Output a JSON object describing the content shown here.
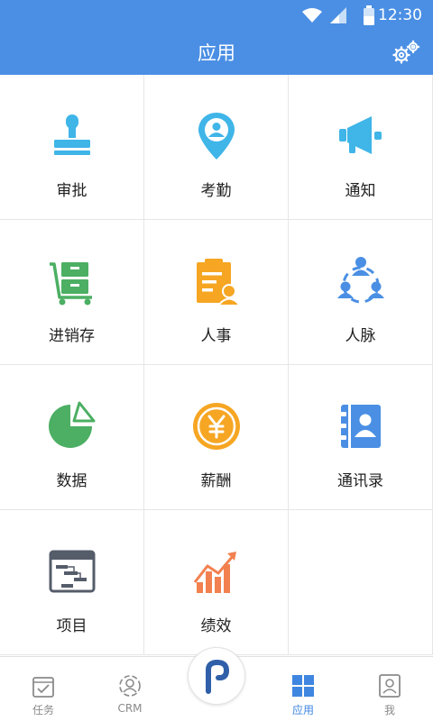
{
  "status_bar": {
    "time": "12:30",
    "icons": [
      "wifi-icon",
      "signal-icon",
      "battery-icon"
    ]
  },
  "header": {
    "title": "应用",
    "settings_icon": "gear-icon"
  },
  "apps": [
    {
      "label": "审批",
      "icon": "stamp-icon",
      "color": "#3fb5e8"
    },
    {
      "label": "考勤",
      "icon": "location-person-icon",
      "color": "#3fb5e8"
    },
    {
      "label": "通知",
      "icon": "megaphone-icon",
      "color": "#3fb5e8"
    },
    {
      "label": "进销存",
      "icon": "cart-icon",
      "color": "#4caf63"
    },
    {
      "label": "人事",
      "icon": "clipboard-person-icon",
      "color": "#f6a623"
    },
    {
      "label": "人脉",
      "icon": "network-people-icon",
      "color": "#4a8fe4"
    },
    {
      "label": "数据",
      "icon": "pie-chart-icon",
      "color": "#4caf63"
    },
    {
      "label": "薪酬",
      "icon": "yuan-coin-icon",
      "color": "#f6a623"
    },
    {
      "label": "通讯录",
      "icon": "contacts-book-icon",
      "color": "#4a8fe4"
    },
    {
      "label": "项目",
      "icon": "gantt-chart-icon",
      "color": "#555c6a"
    },
    {
      "label": "绩效",
      "icon": "bar-chart-trend-icon",
      "color": "#f2814f"
    }
  ],
  "tabs": [
    {
      "label": "任务",
      "icon": "task-icon",
      "active": false
    },
    {
      "label": "CRM",
      "icon": "crm-icon",
      "active": false
    },
    {
      "label": "",
      "icon": "logo-icon",
      "active": false
    },
    {
      "label": "应用",
      "icon": "grid-icon",
      "active": true
    },
    {
      "label": "我",
      "icon": "profile-icon",
      "active": false
    }
  ],
  "colors": {
    "header": "#4a8fe4",
    "active_tab": "#3f86e0",
    "inactive_tab": "#8a8a8a"
  }
}
